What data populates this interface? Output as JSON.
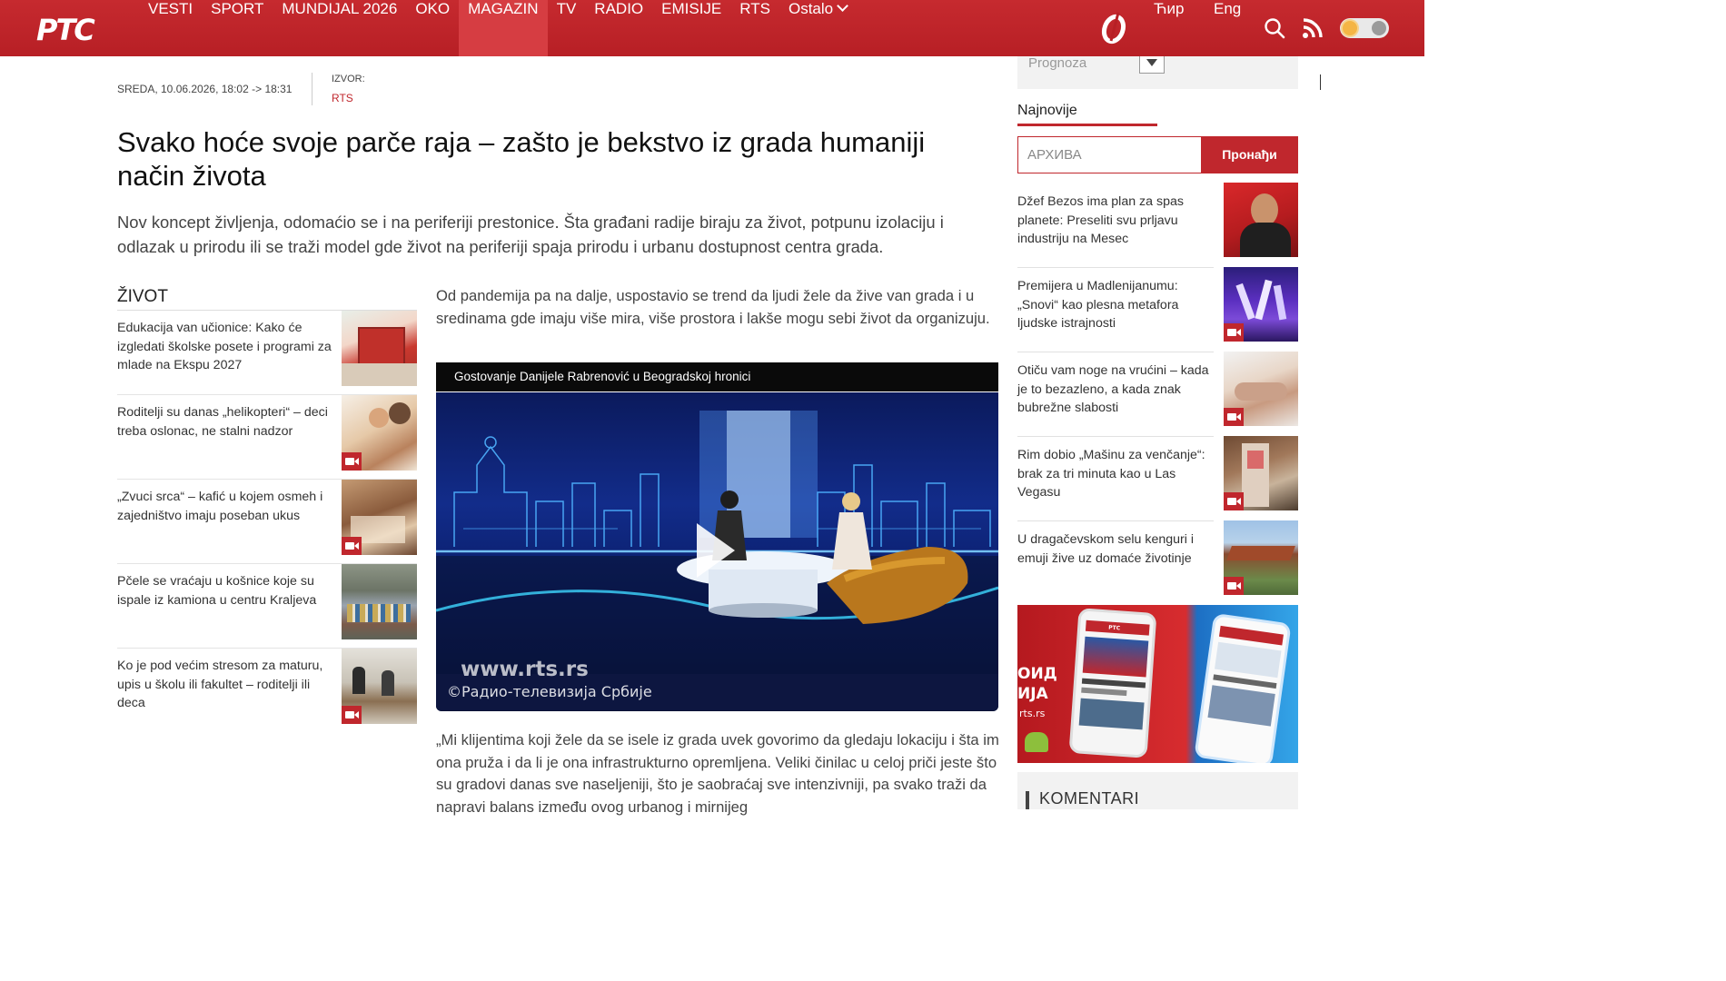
{
  "header": {
    "logo": "РТС",
    "nav": [
      {
        "label": "VESTI"
      },
      {
        "label": "SPORT"
      },
      {
        "label": "MUNDIJAL 2026"
      },
      {
        "label": "OKO"
      },
      {
        "label": "MAGAZIN",
        "active": true
      },
      {
        "label": "TV"
      },
      {
        "label": "RADIO"
      },
      {
        "label": "EMISIJE"
      },
      {
        "label": "RTS"
      },
      {
        "label": "Ostalo",
        "has_dropdown": true
      }
    ],
    "lang_cyrillic": "Ћир",
    "lang_english": "Eng",
    "icons": [
      "brand-icon",
      "search-icon",
      "rss-icon",
      "theme-toggle"
    ],
    "accent_color": "#c0272d"
  },
  "article": {
    "date": "SREDA, 10.06.2026, 18:02 -> 18:31",
    "source_label": "IZVOR:",
    "source": "RTS",
    "title": "Svako hoće svoje parče raja – zašto je bekstvo iz grada humaniji način života",
    "lead": "Nov koncept življenja, odomaćio se i na periferiji prestonice. Šta građani radije biraju za život, potpunu izolaciju i odlazak u prirodu ili se traži model gde život na periferiji spaja prirodu i urbanu dostupnost centra grada.",
    "paragraph_1": "Od pandemija pa na dalje, uspostavio se trend da ljudi žele da žive van grada i u sredinama gde imaju više mira, više prostora i lakše mogu sebi život da organizuju.",
    "video": {
      "caption": "Gostovanje Danijele Rabrenović u Beogradskoj hronici",
      "watermark_url": "www.rts.rs",
      "watermark_copyright": "©Радио-телевизија Србије"
    },
    "paragraph_2": "„Mi klijentima koji žele da se isele iz grada uvek govorimo da gledaju lokaciju i šta im ona pruža i da li je ona infrastrukturno opremljena. Veliki činilac u celoj priči jeste što su gradovi danas sve naseljeniji, što je saobraćaj sve intenzivniji, pa svako traži da napravi balans između ovog urbanog i mirnijeg"
  },
  "related": {
    "section_title": "ŽIVOT",
    "items": [
      {
        "text": "Edukacija van učionice: Kako će izgledati školske posete i programi za mlade na Ekspu 2027",
        "video": false
      },
      {
        "text": "Roditelji su danas „helikopteri“ – deci treba oslonac, ne stalni nadzor",
        "video": true
      },
      {
        "text": "„Zvuci srca“ – kafić u kojem osmeh i zajedništvo imaju poseban ukus",
        "video": true
      },
      {
        "text": "Pčele se vraćaju u košnice koje su ispale iz kamiona u centru Kraljeva",
        "video": false
      },
      {
        "text": "Ko je pod većim stresom za maturu, upis u školu ili fakultet – roditelji ili deca",
        "video": true
      }
    ]
  },
  "sidebar": {
    "weather_label": "Prognoza",
    "newest_title": "Najnovije",
    "archive_placeholder": "АРХИВА",
    "archive_button": "Пронађи",
    "news": [
      {
        "text": "Džef Bezos ima plan za spas planete: Preseliti svu prljavu industriju na Mesec",
        "video": false
      },
      {
        "text": "Premijera u Madlenijanumu: „Snovi“ kao plesna metafora ljudske istrajnosti",
        "video": true
      },
      {
        "text": "Otiču vam noge na vrućini – kada je to bezazleno, a kada znak bubrežne slabosti",
        "video": true
      },
      {
        "text": "Rim dobio „Mašinu za venčanje“: brak za tri minuta kao u Las Vegasu",
        "video": true
      },
      {
        "text": "U dragačevskom selu kenguri i emuji žive uz domaće životinje",
        "video": true
      }
    ],
    "banner_logo": "РТС",
    "banner_left_text": [
      "ОИД",
      "ИЈА",
      "rts.rs"
    ],
    "comments_title": "KOMENTARI"
  }
}
